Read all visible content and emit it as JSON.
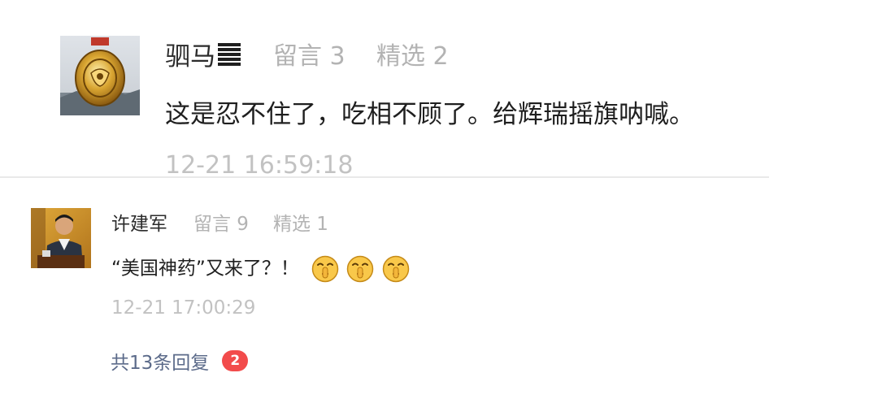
{
  "comments": [
    {
      "author": "驷马",
      "author_suffix_icon": "trigram-heaven-icon",
      "messages_label": "留言 3",
      "featured_label": "精选 2",
      "text": "这是忍不住了，吃相不顾了。给辉瑞摇旗呐喊。",
      "timestamp": "12-21 16:59:18",
      "avatar": "medal-avatar"
    },
    {
      "author": "许建军",
      "messages_label": "留言 9",
      "featured_label": "精选 1",
      "text": "“美国神药”又来了？！",
      "emojis": [
        "shushing-face-icon",
        "shushing-face-icon",
        "shushing-face-icon"
      ],
      "timestamp": "12-21 17:00:29",
      "avatar": "person-avatar"
    }
  ],
  "replies": {
    "label": "共13条回复",
    "badge": "2"
  },
  "colors": {
    "link": "#5c6b8a",
    "badge": "#f24b4b",
    "meta": "#b3b3b3",
    "divider": "#e9e9e9"
  }
}
